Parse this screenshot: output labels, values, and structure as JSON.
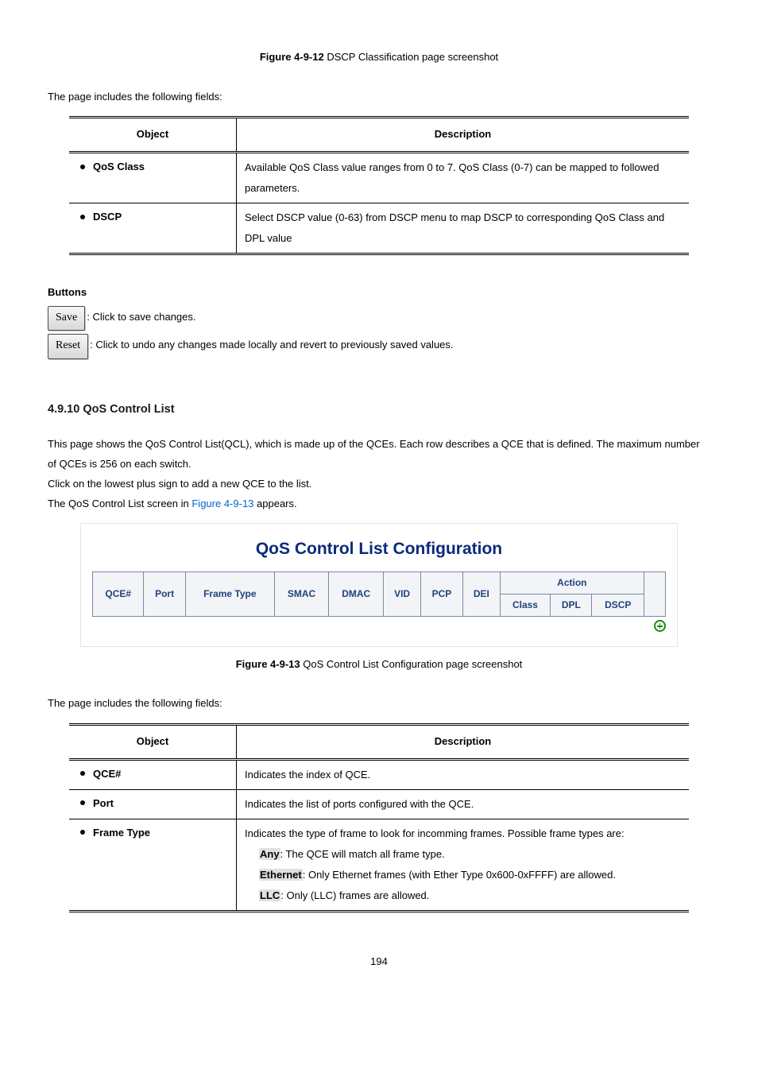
{
  "fig1_caption_prefix": "Figure 4-9-12 ",
  "fig1_caption_text": "DSCP Classification page screenshot",
  "fields_intro": "The page includes the following fields:",
  "table1": {
    "head_obj": "Object",
    "head_desc": "Description",
    "rows": [
      {
        "obj": "QoS Class",
        "desc": "Available QoS Class value ranges from 0 to 7. QoS Class (0-7) can be mapped to followed parameters."
      },
      {
        "obj": "DSCP",
        "desc": "Select DSCP value (0-63) from DSCP menu to map DSCP to corresponding QoS Class and DPL value"
      }
    ]
  },
  "buttons_title": "Buttons",
  "save_btn": "Save",
  "save_text": ": Click to save changes.",
  "reset_btn": "Reset",
  "reset_text": ": Click to undo any changes made locally and revert to previously saved values.",
  "section_num": "4.9.10 QoS Control List",
  "para1": "This page shows the QoS Control List(QCL), which is made up of the QCEs. Each row describes a QCE that is defined. The maximum number of QCEs is 256 on each switch.",
  "para2": "Click on the lowest plus sign to add a new QCE to the list.",
  "para3a": "The QoS Control List screen in ",
  "para3_link": "Figure 4-9-13",
  "para3b": " appears.",
  "qcl_title": "QoS Control List Configuration",
  "qcl_headers": {
    "qce": "QCE#",
    "port": "Port",
    "ftype": "Frame Type",
    "smac": "SMAC",
    "dmac": "DMAC",
    "vid": "VID",
    "pcp": "PCP",
    "dei": "DEI",
    "action": "Action",
    "class": "Class",
    "dpl": "DPL",
    "dscp": "DSCP"
  },
  "fig2_caption_prefix": "Figure 4-9-13 ",
  "fig2_caption_text": "QoS Control List Configuration page screenshot",
  "table2": {
    "head_obj": "Object",
    "head_desc": "Description",
    "rows": [
      {
        "obj": "QCE#",
        "desc": "Indicates the index of QCE."
      },
      {
        "obj": "Port",
        "desc": "Indicates the list of ports configured with the QCE."
      }
    ],
    "row3_obj": "Frame Type",
    "row3_intro": "Indicates the type of frame to look for incomming frames. Possible frame types are:",
    "row3_items": [
      {
        "lbl": "Any",
        "txt": ": The QCE will match all frame type."
      },
      {
        "lbl": "Ethernet",
        "txt": ": Only Ethernet frames (with Ether Type 0x600-0xFFFF) are allowed."
      },
      {
        "lbl": "LLC",
        "txt": ": Only (LLC) frames are allowed."
      }
    ]
  },
  "page_number": "194"
}
